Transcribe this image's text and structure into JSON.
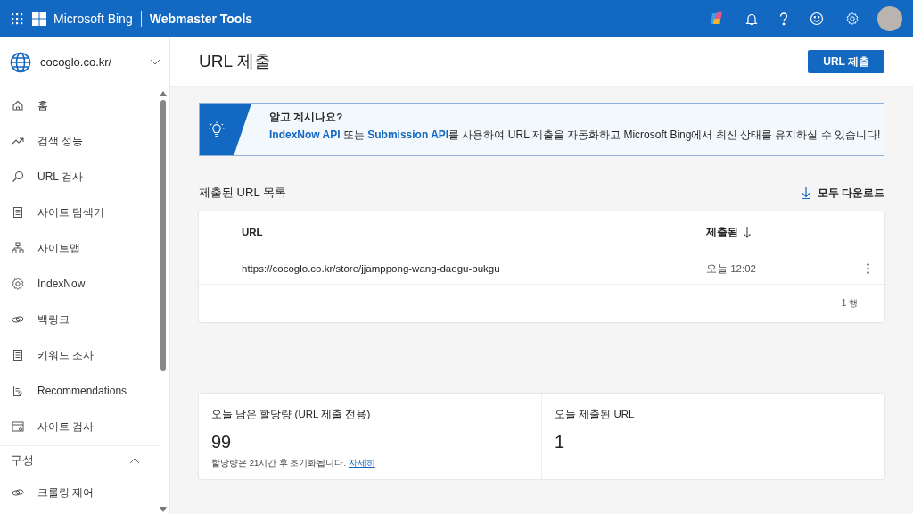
{
  "header": {
    "brand": "Microsoft Bing",
    "product": "Webmaster Tools"
  },
  "site": {
    "name": "cocoglo.co.kr/"
  },
  "nav": {
    "items": [
      {
        "label": "홈"
      },
      {
        "label": "검색 성능"
      },
      {
        "label": "URL 검사"
      },
      {
        "label": "사이트 탐색기"
      },
      {
        "label": "사이트맵"
      },
      {
        "label": "IndexNow"
      },
      {
        "label": "백링크"
      },
      {
        "label": "키워드 조사"
      },
      {
        "label": "Recommendations"
      },
      {
        "label": "사이트 검사"
      }
    ],
    "section": {
      "label": "구성",
      "expanded": true,
      "items": [
        {
          "label": "크롤링 제어"
        }
      ]
    }
  },
  "page": {
    "title": "URL 제출",
    "button": "URL 제출"
  },
  "banner": {
    "title": "알고 계시나요?",
    "parts": [
      {
        "kind": "link",
        "text": "IndexNow API"
      },
      {
        "kind": "text",
        "text": " 또는 "
      },
      {
        "kind": "link",
        "text": "Submission API"
      },
      {
        "kind": "text",
        "text": "를 사용하여 URL 제출을 자동화하고 Microsoft Bing에서 최신 상태를 유지하실 수 있습니다!"
      }
    ]
  },
  "list": {
    "title": "제출된 URL 목록",
    "download": "모두 다운로드",
    "columns": [
      {
        "label": "URL",
        "sorted": false
      },
      {
        "label": "제출됨",
        "sorted": true
      }
    ],
    "rows": [
      {
        "url": "https://cocoglo.co.kr/store/jjamppong-wang-daegu-bukgu",
        "time": "오늘 12:02"
      }
    ],
    "footer": "1 행"
  },
  "stats": [
    {
      "label": "오늘 남은 할당량 (URL 제출 전용)",
      "value": "99",
      "note": "할당량은 21시간 후 초기화됩니다.",
      "link": "자세히"
    },
    {
      "label": "오늘 제출된 URL",
      "value": "1"
    }
  ]
}
